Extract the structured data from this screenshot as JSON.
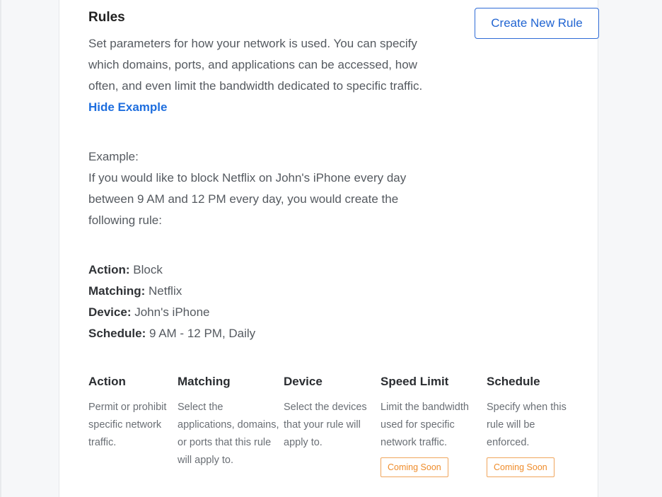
{
  "header": {
    "title": "Rules",
    "description": "Set parameters for how your network is used. You can specify which domains, ports, and applications can be accessed, how often, and even limit the bandwidth dedicated to specific traffic.",
    "hide_example": "Hide Example",
    "create_button": "Create New Rule"
  },
  "example": {
    "label": "Example:",
    "text": "If you would like to block Netflix on John's iPhone every day between 9 AM and 12 PM every day, you would create the following rule:",
    "action_label": "Action:",
    "action_value": " Block",
    "matching_label": "Matching:",
    "matching_value": " Netflix",
    "device_label": "Device:",
    "device_value": " John's iPhone",
    "schedule_label": "Schedule:",
    "schedule_value": " 9 AM - 12 PM, Daily"
  },
  "columns": [
    {
      "title": "Action",
      "text": "Permit or prohibit specific network traffic."
    },
    {
      "title": "Matching",
      "text": "Select the applications, domains, or ports that this rule will apply to."
    },
    {
      "title": "Device",
      "text": "Select the devices that your rule will apply to."
    },
    {
      "title": "Speed Limit",
      "text": "Limit the bandwidth used for specific network traffic.",
      "badge": "Coming Soon"
    },
    {
      "title": "Schedule",
      "text": "Specify when this rule will be enforced.",
      "badge": "Coming Soon"
    }
  ],
  "colors": {
    "accent": "#1e6ede",
    "badge": "#ef8c2a"
  }
}
